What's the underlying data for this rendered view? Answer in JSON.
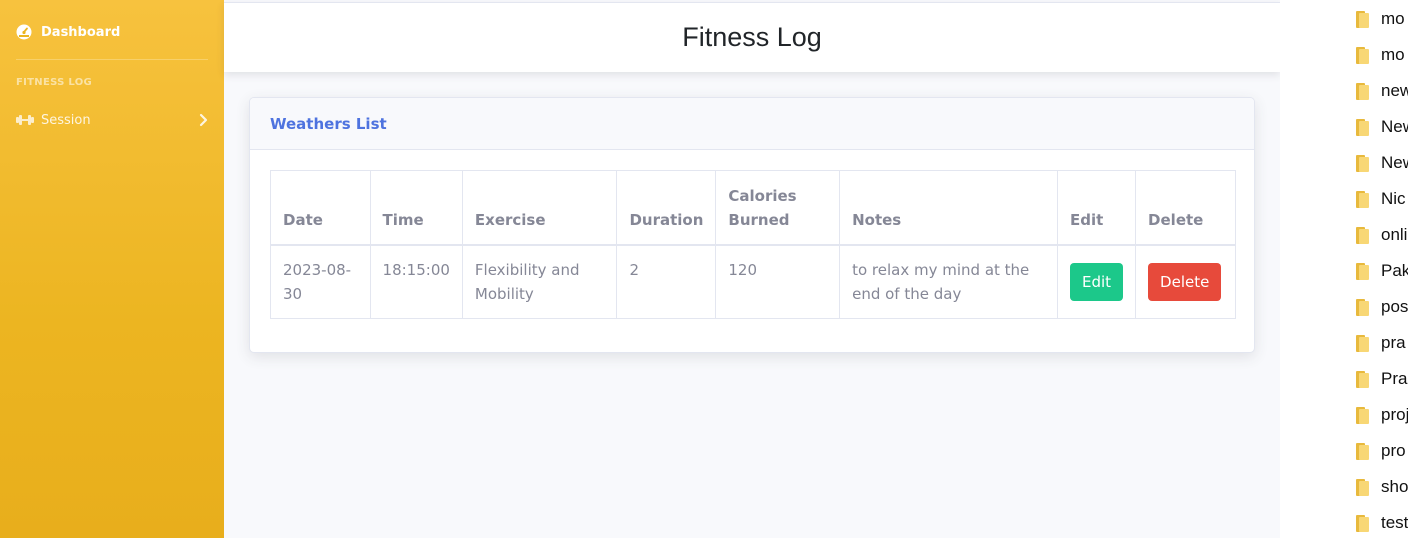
{
  "sidebar": {
    "dashboard_label": "Dashboard",
    "section_heading": "FITNESS LOG",
    "session_label": "Session"
  },
  "header": {
    "title": "Fitness Log"
  },
  "card": {
    "title": "Weathers List",
    "columns": [
      "Date",
      "Time",
      "Exercise",
      "Duration",
      "Calories Burned",
      "Notes",
      "Edit",
      "Delete"
    ],
    "rows": [
      {
        "date": "2023-08-30",
        "time": "18:15:00",
        "exercise": "Flexibility and Mobility",
        "duration": "2",
        "calories": "120",
        "notes": "to relax my mind at the end of the day",
        "edit_label": "Edit",
        "delete_label": "Delete"
      }
    ]
  },
  "file_panel": {
    "items": [
      "mo",
      "mo",
      "new",
      "New",
      "New",
      "Nic",
      "onli",
      "Pak",
      "pos",
      "pra",
      "Prac",
      "proj",
      "pro",
      "sho",
      "test"
    ]
  },
  "colors": {
    "sidebar": "#f6c23e",
    "accent": "#4e73df",
    "edit": "#1cc88a",
    "delete": "#e74a3b"
  }
}
